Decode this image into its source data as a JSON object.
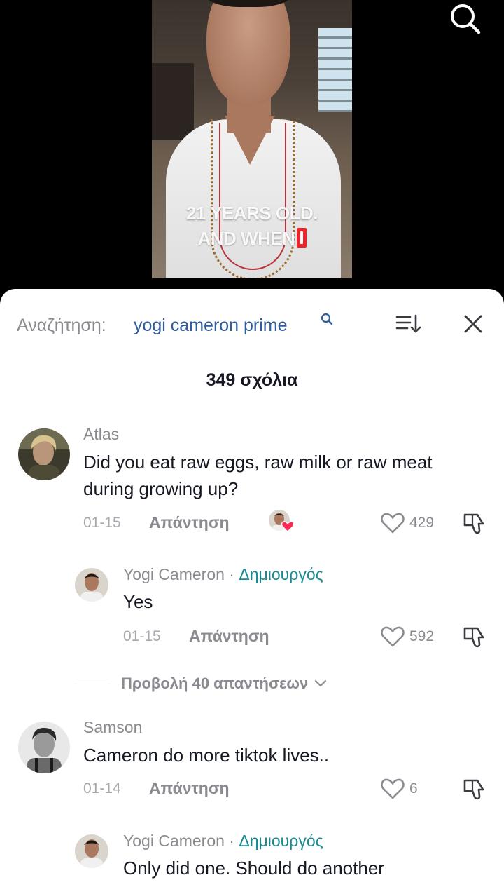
{
  "video": {
    "caption_line1": "21 YEARS OLD.",
    "caption_line2": "AND WHEN"
  },
  "header": {
    "search_prefix": "Αναζήτηση:",
    "search_query": "yogi cameron prime"
  },
  "comment_count": "349 σχόλια",
  "comments": [
    {
      "username": "Atlas",
      "text": "Did you eat raw eggs, raw milk or raw meat during growing up?",
      "date": "01-15",
      "reply_label": "Απάντηση",
      "likes": "429"
    },
    {
      "username": "Yogi Cameron",
      "creator_badge": "Δημιουργός",
      "separator": " · ",
      "text": "Yes",
      "date": "01-15",
      "reply_label": "Απάντηση",
      "likes": "592"
    },
    {
      "username": "Samson",
      "text": "Cameron do more tiktok lives..",
      "date": "01-14",
      "reply_label": "Απάντηση",
      "likes": "6"
    },
    {
      "username": "Yogi Cameron",
      "creator_badge": "Δημιουργός",
      "separator": " · ",
      "text": "Only did one. Should do another"
    }
  ],
  "view_replies": "Προβολή 40 απαντήσεων",
  "colors": {
    "accent_link": "#2f5c9c",
    "creator": "#168b93",
    "heart": "#fe2c55"
  },
  "icons": [
    "search-icon",
    "sort-icon",
    "close-icon",
    "heart-icon",
    "dislike-icon",
    "chevron-down-icon"
  ]
}
